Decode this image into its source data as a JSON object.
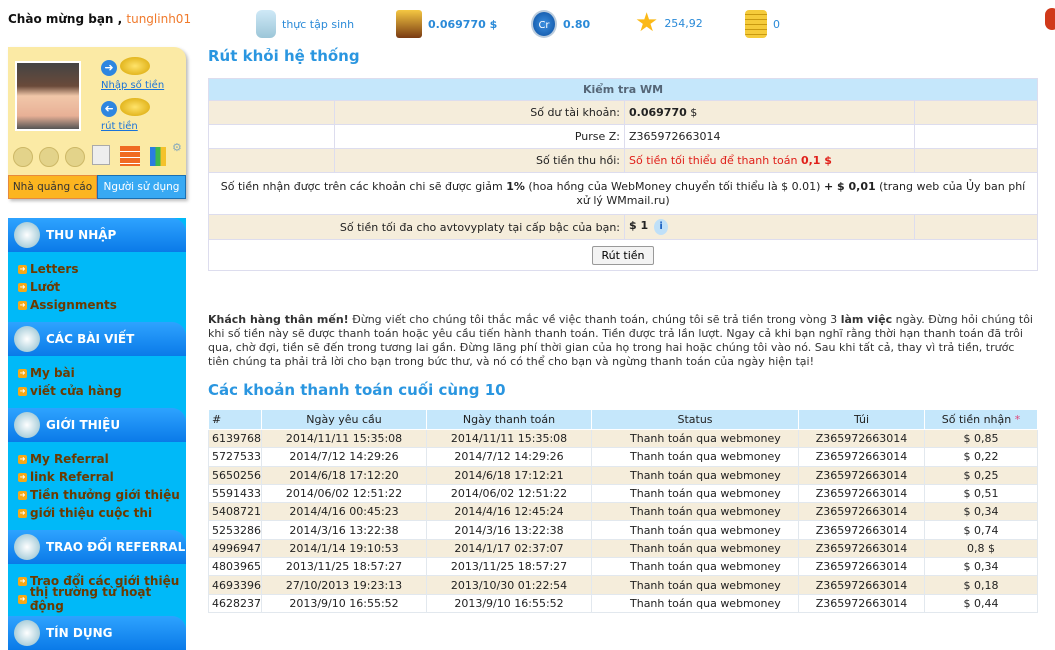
{
  "topbar": {
    "welcome": "Chào mừng bạn",
    "username": "tunglinh01",
    "rank": "thực tập sinh",
    "balance": "0.069770 $",
    "credit": "0.80",
    "rating": "254,92",
    "coins": "0",
    "credit_icon_label": "Cr"
  },
  "profile": {
    "deposit_link": "Nhập số tiền",
    "withdraw_link": "rút tiền",
    "tab_advertiser": "Nhà quảng cáo",
    "tab_user": "Người sử dụng"
  },
  "menu": [
    {
      "title": "THU NHẬP",
      "items": [
        "Letters",
        "Lướt",
        "Assignments"
      ]
    },
    {
      "title": "CÁC BÀI VIẾT",
      "items": [
        "My bài",
        "viết cửa hàng"
      ]
    },
    {
      "title": "GIỚI THIỆU",
      "items": [
        "My Referral",
        "link Referral",
        "Tiền thưởng giới thiệu",
        "giới thiệu cuộc thi"
      ]
    },
    {
      "title": "TRAO ĐỔI REFERRAL",
      "items": [
        "Trao đổi các giới thiệu",
        "thị trường từ hoạt động"
      ]
    },
    {
      "title": "TÍN DỤNG",
      "items": []
    }
  ],
  "withdraw": {
    "title": "Rút khỏi hệ thống",
    "table_header": "Kiểm tra WM",
    "balance_label": "Số dư tài khoản:",
    "balance_value": "0.069770",
    "balance_unit": "$",
    "purse_label": "Purse Z:",
    "purse_value": "Z365972663014",
    "recall_label": "Số tiền thu hồi:",
    "recall_value": "Số tiền tối thiểu để thanh toán",
    "recall_min": "0,1 $",
    "fee_note_1": "Số tiền nhận được trên các khoản chi sẽ được giảm",
    "fee_pct": "1%",
    "fee_note_2": "(hoa hồng của WebMoney chuyển tối thiểu là $ 0.01)",
    "fee_plus": "+ $ 0,01",
    "fee_note_3": "(trang web của Ủy ban phí xử lý WMmail.ru)",
    "max_label": "Số tiền tối đa cho avtovyplaty tại cấp bậc của bạn:",
    "max_value": "$ 1",
    "button": "Rút tiền"
  },
  "note": {
    "bold1": "Khách hàng thân mến!",
    "text1": " Đừng viết cho chúng tôi thắc mắc về việc thanh toán, chúng tôi sẽ trả tiền trong vòng 3 ",
    "bold2": "làm việc",
    "text2": " ngày. Đừng hỏi chúng tôi khi số tiền này sẽ được thanh toán hoặc yêu cầu tiến hành thanh toán. Tiền được trả lần lượt. Ngay cả khi bạn nghĩ rằng thời hạn thanh toán đã trôi qua, chờ đợi, tiền sẽ đến trong tương lai gần. Đừng lãng phí thời gian của họ trong hai hoặc chúng tôi vào nó. Sau khi tất cả, thay vì trả tiền, trước tiên chúng ta phải trả lời cho bạn trong bức thư, và nó có thể cho bạn và ngừng thanh toán của ngày hiện tại!"
  },
  "payments": {
    "title": "Các khoản thanh toán cuối cùng 10",
    "columns": [
      "#",
      "Ngày yêu cầu",
      "Ngày thanh toán",
      "Status",
      "Túi",
      "Số tiền nhận"
    ],
    "asterisk": "*",
    "rows": [
      [
        "6139768",
        "2014/11/11 15:35:08",
        "2014/11/11 15:35:08",
        "Thanh toán qua webmoney",
        "Z365972663014",
        "$ 0,85"
      ],
      [
        "5727533",
        "2014/7/12 14:29:26",
        "2014/7/12 14:29:26",
        "Thanh toán qua webmoney",
        "Z365972663014",
        "$ 0,22"
      ],
      [
        "5650256",
        "2014/6/18 17:12:20",
        "2014/6/18 17:12:21",
        "Thanh toán qua webmoney",
        "Z365972663014",
        "$ 0,25"
      ],
      [
        "5591433",
        "2014/06/02 12:51:22",
        "2014/06/02 12:51:22",
        "Thanh toán qua webmoney",
        "Z365972663014",
        "$ 0,51"
      ],
      [
        "5408721",
        "2014/4/16 00:45:23",
        "2014/4/16 12:45:24",
        "Thanh toán qua webmoney",
        "Z365972663014",
        "$ 0,34"
      ],
      [
        "5253286",
        "2014/3/16 13:22:38",
        "2014/3/16 13:22:38",
        "Thanh toán qua webmoney",
        "Z365972663014",
        "$ 0,74"
      ],
      [
        "4996947",
        "2014/1/14 19:10:53",
        "2014/1/17 02:37:07",
        "Thanh toán qua webmoney",
        "Z365972663014",
        "0,8 $"
      ],
      [
        "4803965",
        "2013/11/25 18:57:27",
        "2013/11/25 18:57:27",
        "Thanh toán qua webmoney",
        "Z365972663014",
        "$ 0,34"
      ],
      [
        "4693396",
        "27/10/2013 19:23:13",
        "2013/10/30 01:22:54",
        "Thanh toán qua webmoney",
        "Z365972663014",
        "$ 0,18"
      ],
      [
        "4628237",
        "2013/9/10 16:55:52",
        "2013/9/10 16:55:52",
        "Thanh toán qua webmoney",
        "Z365972663014",
        "$ 0,44"
      ]
    ]
  }
}
